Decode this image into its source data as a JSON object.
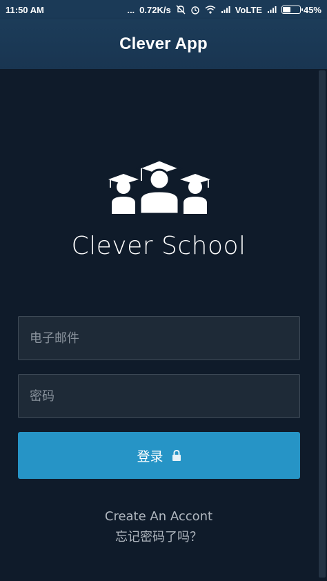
{
  "status_bar": {
    "time": "11:50 AM",
    "dots": "...",
    "speed": "0.72K/s",
    "network": "VoLTE",
    "battery": "45%",
    "battery_level": 0.45
  },
  "app_bar": {
    "title": "Clever App"
  },
  "login": {
    "school_name": "Clever School",
    "email_placeholder": "电子邮件",
    "password_placeholder": "密码",
    "login_label": "登录",
    "create_account": "Create An Accont",
    "forgot_password": "忘记密码了吗？"
  },
  "colors": {
    "status_bar": "#1b3a57",
    "app_bar": "#1c3c59",
    "background": "#0f1b2a",
    "field_bg": "#1e2a37",
    "button": "#2694c6"
  },
  "icons": [
    "mute-icon",
    "alarm-icon",
    "wifi-icon",
    "signal-icon",
    "battery-icon",
    "graduates-logo-icon",
    "lock-icon"
  ]
}
